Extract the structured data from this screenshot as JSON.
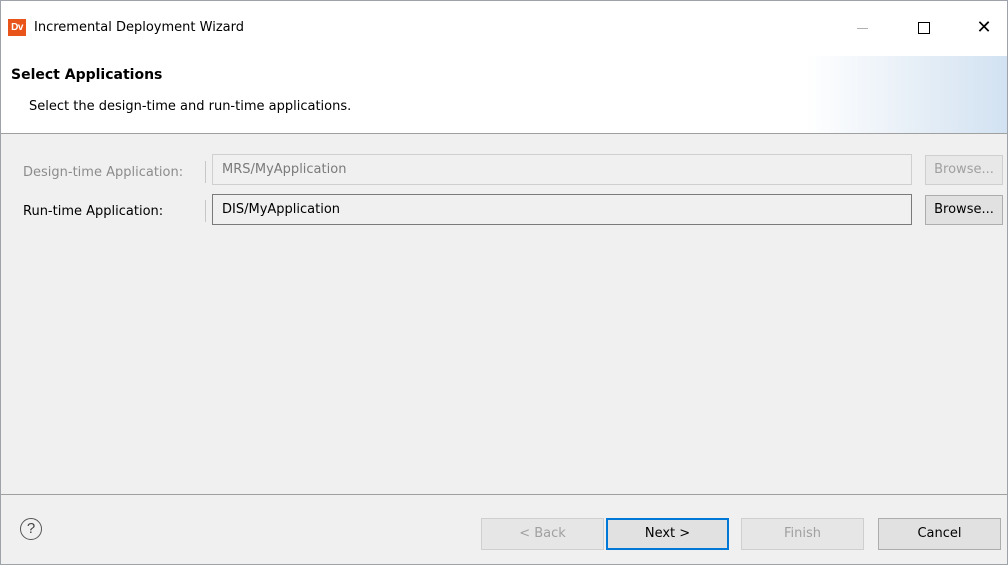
{
  "window": {
    "app_icon_text": "Dv",
    "title": "Incremental Deployment Wizard",
    "close_glyph": "✕",
    "help_glyph": "?"
  },
  "header": {
    "heading": "Select Applications",
    "description": "Select the design-time and run-time applications."
  },
  "form": {
    "design_time": {
      "label": "Design-time Application:",
      "value": "MRS/MyApplication",
      "browse_label": "Browse..."
    },
    "run_time": {
      "label": "Run-time Application:",
      "value": "DIS/MyApplication",
      "browse_label": "Browse..."
    }
  },
  "footer": {
    "back_label": "< Back",
    "next_label": "Next >",
    "finish_label": "Finish",
    "cancel_label": "Cancel"
  },
  "icons": {
    "app": "app-logo-icon",
    "minimize": "minimize-icon",
    "maximize": "maximize-icon",
    "close": "close-icon",
    "help": "help-icon"
  },
  "colors": {
    "accent": "#0078d7",
    "app_icon": "#e8541a"
  }
}
